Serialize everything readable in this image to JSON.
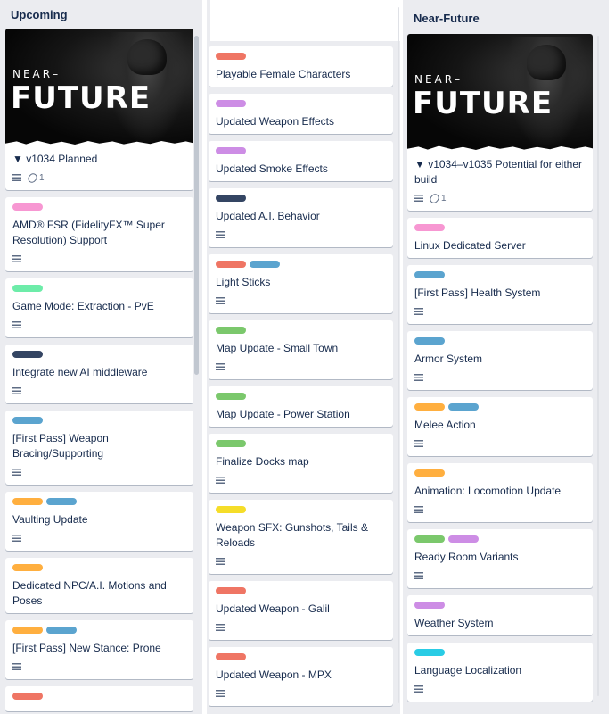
{
  "colors": {
    "pink": "#f797d2",
    "green": "#7bc86c",
    "mint": "#6deca9",
    "navy": "#344563",
    "blue": "#5ba4cf",
    "orange": "#ffaf3f",
    "red": "#ef7564",
    "purple": "#cd8de5",
    "yellow": "#f5dd29",
    "sky": "#29cce5"
  },
  "lists": [
    {
      "title": "Upcoming",
      "cards": [
        {
          "cover": {
            "logo_small": "NEAR–",
            "logo_large": "FUTURE"
          },
          "labels": [],
          "title": "▼ v1034 Planned",
          "desc": true,
          "attachments": "1"
        },
        {
          "labels": [
            "pink"
          ],
          "title": "AMD® FSR (FidelityFX™ Super Resolution) Support",
          "desc": true
        },
        {
          "labels": [
            "mint"
          ],
          "title": "Game Mode: Extraction - PvE",
          "desc": true
        },
        {
          "labels": [
            "navy"
          ],
          "title": "Integrate new AI middleware",
          "desc": true
        },
        {
          "labels": [
            "blue"
          ],
          "title": "[First Pass] Weapon Bracing/Supporting",
          "desc": true
        },
        {
          "labels": [
            "orange",
            "blue"
          ],
          "title": "Vaulting Update",
          "desc": true
        },
        {
          "labels": [
            "orange"
          ],
          "title": "Dedicated NPC/A.I. Motions and Poses",
          "desc": false
        },
        {
          "labels": [
            "orange",
            "blue"
          ],
          "title": "[First Pass] New Stance: Prone",
          "desc": true
        },
        {
          "labels": [
            "red"
          ],
          "title": "",
          "desc": false
        }
      ]
    },
    {
      "title": "",
      "cards": [
        {
          "labels": [
            "red"
          ],
          "title": "Playable Female Characters",
          "desc": false
        },
        {
          "labels": [
            "purple"
          ],
          "title": "Updated Weapon Effects",
          "desc": false
        },
        {
          "labels": [
            "purple"
          ],
          "title": "Updated Smoke Effects",
          "desc": false
        },
        {
          "labels": [
            "navy"
          ],
          "title": "Updated A.I. Behavior",
          "desc": true
        },
        {
          "labels": [
            "red",
            "blue"
          ],
          "title": "Light Sticks",
          "desc": true
        },
        {
          "labels": [
            "green"
          ],
          "title": "Map Update - Small Town",
          "desc": true
        },
        {
          "labels": [
            "green"
          ],
          "title": "Map Update - Power Station",
          "desc": false
        },
        {
          "labels": [
            "green"
          ],
          "title": "Finalize Docks map",
          "desc": true
        },
        {
          "labels": [
            "yellow"
          ],
          "title": "Weapon SFX: Gunshots, Tails & Reloads",
          "desc": true
        },
        {
          "labels": [
            "red"
          ],
          "title": "Updated Weapon - Galil",
          "desc": true
        },
        {
          "labels": [
            "red"
          ],
          "title": "Updated Weapon - MPX",
          "desc": true
        }
      ]
    },
    {
      "title": "Near-Future",
      "cards": [
        {
          "cover": {
            "logo_small": "NEAR–",
            "logo_large": "FUTURE"
          },
          "labels": [],
          "title": "▼ v1034–v1035 Potential for either build",
          "desc": true,
          "attachments": "1"
        },
        {
          "labels": [
            "pink"
          ],
          "title": "Linux Dedicated Server",
          "desc": false
        },
        {
          "labels": [
            "blue"
          ],
          "title": "[First Pass] Health System",
          "desc": true
        },
        {
          "labels": [
            "blue"
          ],
          "title": "Armor System",
          "desc": true
        },
        {
          "labels": [
            "orange",
            "blue"
          ],
          "title": "Melee Action",
          "desc": true
        },
        {
          "labels": [
            "orange"
          ],
          "title": "Animation: Locomotion Update",
          "desc": true
        },
        {
          "labels": [
            "green",
            "purple"
          ],
          "title": "Ready Room Variants",
          "desc": true
        },
        {
          "labels": [
            "purple"
          ],
          "title": "Weather System",
          "desc": false
        },
        {
          "labels": [
            "sky"
          ],
          "title": "Language Localization",
          "desc": true
        }
      ]
    }
  ]
}
